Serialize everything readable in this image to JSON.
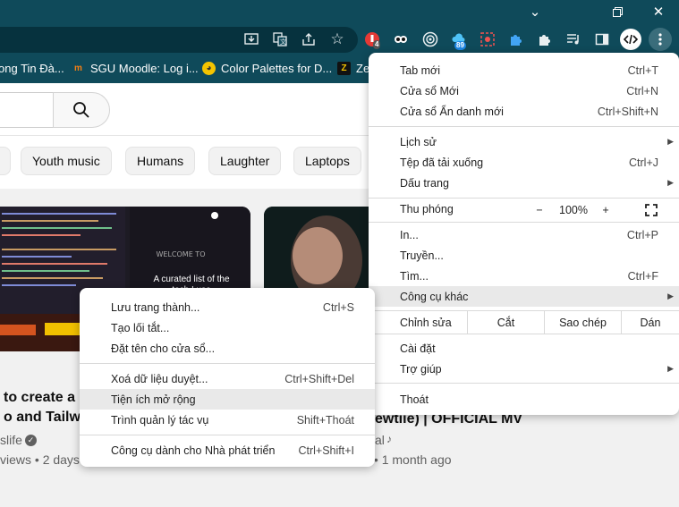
{
  "bookmarks": [
    {
      "label": "ong Tin Đà...",
      "icon": "site-icon"
    },
    {
      "label": "SGU Moodle: Log i...",
      "icon": "moodle-icon"
    },
    {
      "label": "Color Palettes for D...",
      "icon": "palette-icon"
    },
    {
      "label": "Ze",
      "icon": "zalo-icon"
    }
  ],
  "extensions": {
    "badge_1": "4",
    "badge_2": "89"
  },
  "chips": [
    "Youth music",
    "Humans",
    "Laughter",
    "Laptops"
  ],
  "videos": [
    {
      "title_1": "to create a 'V",
      "title_2": "o and Tailwin",
      "channel": "slife",
      "meta": "views • 2 days ago",
      "thumb_text_1": "A curated list of the",
      "thumb_text_2": "tech I use"
    },
    {
      "title": "ewtiie) | OFFICIAL MV",
      "channel": "al",
      "meta": "3.9M views • 1 month ago"
    }
  ],
  "menu": {
    "new_tab": {
      "label": "Tab mới",
      "shortcut": "Ctrl+T"
    },
    "new_window": {
      "label": "Cửa sổ Mới",
      "shortcut": "Ctrl+N"
    },
    "incognito": {
      "label": "Cửa sổ Ẩn danh mới",
      "shortcut": "Ctrl+Shift+N"
    },
    "history": {
      "label": "Lịch sử"
    },
    "downloads": {
      "label": "Tệp đã tải xuống",
      "shortcut": "Ctrl+J"
    },
    "bookmarks": {
      "label": "Dấu trang"
    },
    "zoom": {
      "label": "Thu phóng",
      "minus": "−",
      "value": "100%",
      "plus": "+"
    },
    "print": {
      "label": "In...",
      "shortcut": "Ctrl+P"
    },
    "cast": {
      "label": "Truyền..."
    },
    "find": {
      "label": "Tìm...",
      "shortcut": "Ctrl+F"
    },
    "more_tools": {
      "label": "Công cụ khác"
    },
    "edit": {
      "label": "Chỉnh sửa",
      "cut": "Cắt",
      "copy": "Sao chép",
      "paste": "Dán"
    },
    "settings": {
      "label": "Cài đặt"
    },
    "help": {
      "label": "Trợ giúp"
    },
    "exit": {
      "label": "Thoát"
    }
  },
  "submenu": {
    "save_page": {
      "label": "Lưu trang thành...",
      "shortcut": "Ctrl+S"
    },
    "create_shortcut": {
      "label": "Tạo lối tắt..."
    },
    "name_window": {
      "label": "Đặt tên cho cửa sổ..."
    },
    "clear_data": {
      "label": "Xoá dữ liệu duyệt...",
      "shortcut": "Ctrl+Shift+Del"
    },
    "extensions": {
      "label": "Tiện ích mở rộng"
    },
    "task_manager": {
      "label": "Trình quản lý tác vụ",
      "shortcut": "Shift+Thoát"
    },
    "dev_tools": {
      "label": "Công cụ dành cho Nhà phát triển",
      "shortcut": "Ctrl+Shift+I"
    }
  }
}
